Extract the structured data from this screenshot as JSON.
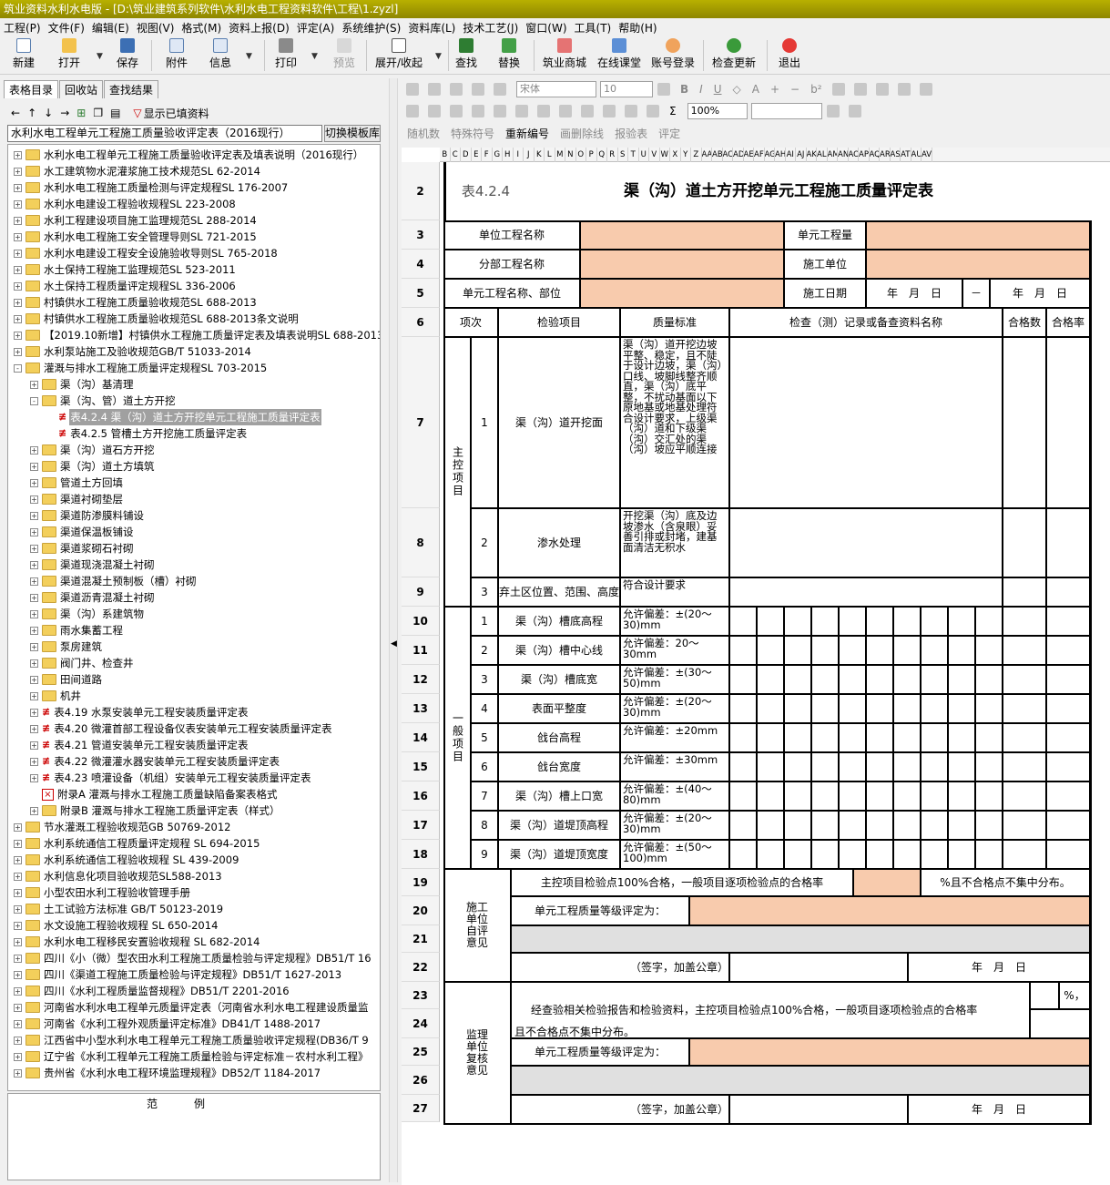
{
  "app": {
    "title": "筑业资料水利水电版 - [D:\\筑业建筑系列软件\\水利水电工程资料软件\\工程\\1.zyzl]"
  },
  "menu": [
    "工程(P)",
    "文件(F)",
    "编辑(E)",
    "视图(V)",
    "格式(M)",
    "资料上报(D)",
    "评定(A)",
    "系统维护(S)",
    "资料库(L)",
    "技术工艺(J)",
    "窗口(W)",
    "工具(T)",
    "帮助(H)"
  ],
  "toolbar": {
    "new": "新建",
    "open": "打开",
    "save": "保存",
    "attach": "附件",
    "info": "信息",
    "print": "打印",
    "preview": "预览",
    "expand": "展开/收起",
    "find": "查找",
    "replace": "替换",
    "mall": "筑业商城",
    "class": "在线课堂",
    "login": "账号登录",
    "update": "检查更新",
    "exit": "退出"
  },
  "left": {
    "tabs": [
      "表格目录",
      "回收站",
      "查找结果"
    ],
    "show_filled": "显示已填资料",
    "spec": "水利水电工程单元工程施工质量验收评定表（2016现行）",
    "switch": "切换模板库",
    "fanli": "范例"
  },
  "tree": [
    {
      "d": 0,
      "t": "f",
      "e": "+",
      "label": "水利水电工程单元工程施工质量验收评定表及填表说明（2016现行）"
    },
    {
      "d": 0,
      "t": "f",
      "e": "+",
      "label": "水工建筑物水泥灌浆施工技术规范SL 62-2014"
    },
    {
      "d": 0,
      "t": "f",
      "e": "+",
      "label": "水利水电工程施工质量检测与评定规程SL 176-2007"
    },
    {
      "d": 0,
      "t": "f",
      "e": "+",
      "label": "水利水电建设工程验收规程SL 223-2008"
    },
    {
      "d": 0,
      "t": "f",
      "e": "+",
      "label": "水利工程建设项目施工监理规范SL 288-2014"
    },
    {
      "d": 0,
      "t": "f",
      "e": "+",
      "label": "水利水电工程施工安全管理导则SL 721-2015"
    },
    {
      "d": 0,
      "t": "f",
      "e": "+",
      "label": "水利水电建设工程安全设施验收导则SL 765-2018"
    },
    {
      "d": 0,
      "t": "f",
      "e": "+",
      "label": "水土保持工程施工监理规范SL 523-2011"
    },
    {
      "d": 0,
      "t": "f",
      "e": "+",
      "label": "水土保持工程质量评定规程SL 336-2006"
    },
    {
      "d": 0,
      "t": "f",
      "e": "+",
      "label": "村镇供水工程施工质量验收规范SL 688-2013"
    },
    {
      "d": 0,
      "t": "f",
      "e": "+",
      "label": "村镇供水工程施工质量验收规范SL 688-2013条文说明"
    },
    {
      "d": 0,
      "t": "f",
      "e": "+",
      "label": "【2019.10新增】村镇供水工程施工质量评定表及填表说明SL 688-2013"
    },
    {
      "d": 0,
      "t": "f",
      "e": "+",
      "label": "水利泵站施工及验收规范GB/T 51033-2014"
    },
    {
      "d": 0,
      "t": "f",
      "e": "-",
      "label": "灌溉与排水工程施工质量评定规程SL 703-2015"
    },
    {
      "d": 1,
      "t": "f",
      "e": "+",
      "label": "渠（沟）基清理"
    },
    {
      "d": 1,
      "t": "f",
      "e": "-",
      "label": "渠（沟、管）道土方开挖"
    },
    {
      "d": 2,
      "t": "x",
      "e": "",
      "label": "表4.2.4 渠（沟）道土方开挖单元工程施工质量评定表",
      "sel": true
    },
    {
      "d": 2,
      "t": "x",
      "e": "",
      "label": "表4.2.5 管槽土方开挖施工质量评定表"
    },
    {
      "d": 1,
      "t": "f",
      "e": "+",
      "label": "渠（沟）道石方开挖"
    },
    {
      "d": 1,
      "t": "f",
      "e": "+",
      "label": "渠（沟）道土方填筑"
    },
    {
      "d": 1,
      "t": "f",
      "e": "+",
      "label": "管道土方回填"
    },
    {
      "d": 1,
      "t": "f",
      "e": "+",
      "label": "渠道衬砌垫层"
    },
    {
      "d": 1,
      "t": "f",
      "e": "+",
      "label": "渠道防渗膜料铺设"
    },
    {
      "d": 1,
      "t": "f",
      "e": "+",
      "label": "渠道保温板铺设"
    },
    {
      "d": 1,
      "t": "f",
      "e": "+",
      "label": "渠道浆砌石衬砌"
    },
    {
      "d": 1,
      "t": "f",
      "e": "+",
      "label": "渠道现浇混凝土衬砌"
    },
    {
      "d": 1,
      "t": "f",
      "e": "+",
      "label": "渠道混凝土预制板（槽）衬砌"
    },
    {
      "d": 1,
      "t": "f",
      "e": "+",
      "label": "渠道沥青混凝土衬砌"
    },
    {
      "d": 1,
      "t": "f",
      "e": "+",
      "label": "渠（沟）系建筑物"
    },
    {
      "d": 1,
      "t": "f",
      "e": "+",
      "label": "雨水集蓄工程"
    },
    {
      "d": 1,
      "t": "f",
      "e": "+",
      "label": "泵房建筑"
    },
    {
      "d": 1,
      "t": "f",
      "e": "+",
      "label": "阀门井、检查井"
    },
    {
      "d": 1,
      "t": "f",
      "e": "+",
      "label": "田间道路"
    },
    {
      "d": 1,
      "t": "f",
      "e": "+",
      "label": "机井"
    },
    {
      "d": 1,
      "t": "x",
      "e": "+",
      "label": "表4.19 水泵安装单元工程安装质量评定表"
    },
    {
      "d": 1,
      "t": "x",
      "e": "+",
      "label": "表4.20 微灌首部工程设备仪表安装单元工程安装质量评定表"
    },
    {
      "d": 1,
      "t": "x",
      "e": "+",
      "label": "表4.21 管道安装单元工程安装质量评定表"
    },
    {
      "d": 1,
      "t": "x",
      "e": "+",
      "label": "表4.22 微灌灌水器安装单元工程安装质量评定表"
    },
    {
      "d": 1,
      "t": "x",
      "e": "+",
      "label": "表4.23 喷灌设备（机组）安装单元工程安装质量评定表"
    },
    {
      "d": 1,
      "t": "r",
      "e": "",
      "label": "附录A 灌溉与排水工程施工质量缺陷备案表格式"
    },
    {
      "d": 1,
      "t": "f",
      "e": "+",
      "label": "附录B 灌溉与排水工程施工质量评定表（样式）"
    },
    {
      "d": 0,
      "t": "f",
      "e": "+",
      "label": "节水灌溉工程验收规范GB 50769-2012"
    },
    {
      "d": 0,
      "t": "f",
      "e": "+",
      "label": "水利系统通信工程质量评定规程 SL 694-2015"
    },
    {
      "d": 0,
      "t": "f",
      "e": "+",
      "label": "水利系统通信工程验收规程 SL 439-2009"
    },
    {
      "d": 0,
      "t": "f",
      "e": "+",
      "label": "水利信息化项目验收规范SL588-2013"
    },
    {
      "d": 0,
      "t": "f",
      "e": "+",
      "label": "小型农田水利工程验收管理手册"
    },
    {
      "d": 0,
      "t": "f",
      "e": "+",
      "label": "土工试验方法标准 GB/T 50123-2019"
    },
    {
      "d": 0,
      "t": "f",
      "e": "+",
      "label": "水文设施工程验收规程 SL 650-2014"
    },
    {
      "d": 0,
      "t": "f",
      "e": "+",
      "label": "水利水电工程移民安置验收规程 SL 682-2014"
    },
    {
      "d": 0,
      "t": "f",
      "e": "+",
      "label": "四川《小（微）型农田水利工程施工质量检验与评定规程》DB51/T 16"
    },
    {
      "d": 0,
      "t": "f",
      "e": "+",
      "label": "四川《渠道工程施工质量检验与评定规程》DB51/T 1627-2013"
    },
    {
      "d": 0,
      "t": "f",
      "e": "+",
      "label": "四川《水利工程质量监督规程》DB51/T 2201-2016"
    },
    {
      "d": 0,
      "t": "f",
      "e": "+",
      "label": "河南省水利水电工程单元质量评定表（河南省水利水电工程建设质量监"
    },
    {
      "d": 0,
      "t": "f",
      "e": "+",
      "label": "河南省《水利工程外观质量评定标准》DB41/T 1488-2017"
    },
    {
      "d": 0,
      "t": "f",
      "e": "+",
      "label": "江西省中小型水利水电工程单元工程施工质量验收评定规程(DB36/T 9"
    },
    {
      "d": 0,
      "t": "f",
      "e": "+",
      "label": "辽宁省《水利工程单元工程施工质量检验与评定标准－农村水利工程》"
    },
    {
      "d": 0,
      "t": "f",
      "e": "+",
      "label": "贵州省《水利水电工程环境监理规程》DB52/T 1184-2017"
    }
  ],
  "fmt": {
    "font": "宋体",
    "size": "10",
    "zoom": "100%",
    "random": "随机数",
    "special": "特殊符号",
    "renumber": "重新编号",
    "strike": "画删除线",
    "report": "报验表",
    "eval": "评定"
  },
  "columns": [
    "B",
    "C",
    "D",
    "E",
    "F",
    "G",
    "H",
    "I",
    "J",
    "K",
    "L",
    "M",
    "N",
    "O",
    "P",
    "Q",
    "R",
    "S",
    "T",
    "U",
    "V",
    "W",
    "X",
    "Y",
    "Z",
    "AA",
    "AB",
    "AC",
    "AD",
    "AE",
    "AF",
    "AG",
    "AH",
    "AI",
    "AJ",
    "AK",
    "AL",
    "AM",
    "AN",
    "AO",
    "AP",
    "AQ",
    "AR",
    "AS",
    "AT",
    "AU",
    "AV"
  ],
  "form": {
    "code": "表4.2.4",
    "title": "渠（沟）道土方开挖单元工程施工质量评定表",
    "unit_project": "单位工程名称",
    "unit_qty": "单元工程量",
    "sub_project": "分部工程名称",
    "contractor": "施工单位",
    "element_name": "单元工程名称、部位",
    "date_label": "施工日期",
    "ymd": "年　月　日",
    "dash": "－",
    "h_item": "项次",
    "h_check": "检验项目",
    "h_std": "质量标准",
    "h_record": "检查（测）记录或备查资料名称",
    "h_pass": "合格数",
    "h_rate": "合格率",
    "main": "主控项目",
    "general": "一般项目",
    "main_items": [
      {
        "no": "1",
        "name": "渠（沟）道开挖面",
        "std": "渠（沟）道开挖边坡平整、稳定，且不陡于设计边坡，渠（沟）口线、坡脚线整齐顺直，渠（沟）底平整，不扰动基面以下原地基或地基处理符合设计要求，上级渠（沟）道和下级渠（沟）交汇处的渠（沟）坡应平顺连接"
      },
      {
        "no": "2",
        "name": "渗水处理",
        "std": "开挖渠（沟）底及边坡渗水（含泉眼）妥善引排或封堵，建基面清洁无积水"
      },
      {
        "no": "3",
        "name": "弃土区位置、范围、高度",
        "std": "符合设计要求"
      }
    ],
    "gen_items": [
      {
        "no": "1",
        "name": "渠（沟）槽底高程",
        "std": "允许偏差：±(20～30)mm"
      },
      {
        "no": "2",
        "name": "渠（沟）槽中心线",
        "std": "允许偏差：20～30mm"
      },
      {
        "no": "3",
        "name": "渠（沟）槽底宽",
        "std": "允许偏差：±(30～50)mm"
      },
      {
        "no": "4",
        "name": "表面平整度",
        "std": "允许偏差：±(20～30)mm"
      },
      {
        "no": "5",
        "name": "戗台高程",
        "std": "允许偏差：±20mm"
      },
      {
        "no": "6",
        "name": "戗台宽度",
        "std": "允许偏差：±30mm"
      },
      {
        "no": "7",
        "name": "渠（沟）槽上口宽",
        "std": "允许偏差：±(40～80)mm"
      },
      {
        "no": "8",
        "name": "渠（沟）道堤顶高程",
        "std": "允许偏差：±(20～30)mm"
      },
      {
        "no": "9",
        "name": "渠（沟）道堤顶宽度",
        "std": "允许偏差：±(50～100)mm"
      }
    ],
    "contractor_opinion": "施工单位自评意见",
    "c_line1": "主控项目检验点100%合格，一般项目逐项检验点的合格率",
    "c_line1b": "%且不合格点不集中分布。",
    "c_grade": "单元工程质量等级评定为：",
    "sign": "（签字，加盖公章）",
    "supervisor_opinion": "监理单位复核意见",
    "s_line1": "经查验相关检验报告和检验资料，主控项目检验点100%合格，一般项目逐项检验点的合格率",
    "s_line1b": "%，",
    "s_line2": "且不合格点不集中分布。",
    "s_grade": "单元工程质量等级评定为：",
    "ymd2": "年　月　日"
  },
  "rows": [
    "2",
    "3",
    "4",
    "5",
    "6",
    "7",
    "8",
    "9",
    "10",
    "11",
    "12",
    "13",
    "14",
    "15",
    "16",
    "17",
    "18",
    "19",
    "20",
    "21",
    "22",
    "23",
    "24",
    "25",
    "26",
    "27"
  ]
}
